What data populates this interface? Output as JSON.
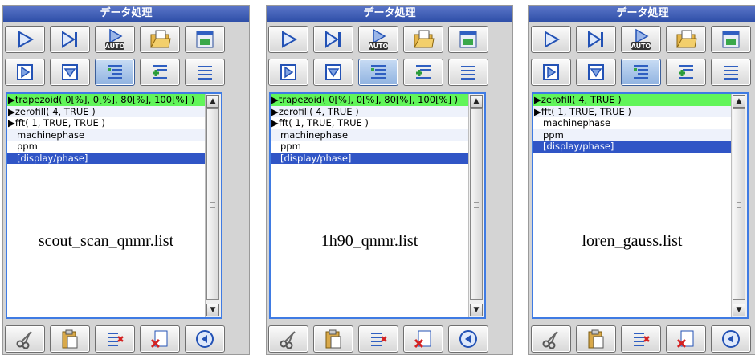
{
  "panels": [
    {
      "title": "データ処理",
      "items": [
        {
          "label": "▶trapezoid( 0[%], 0[%], 80[%], 100[%] )",
          "style": "green"
        },
        {
          "label": "▶zerofill( 4, TRUE )",
          "style": ""
        },
        {
          "label": "▶fft( 1, TRUE, TRUE )",
          "style": ""
        },
        {
          "label": "machinephase",
          "style": "indent"
        },
        {
          "label": "ppm",
          "style": "indent"
        },
        {
          "label": "[display/phase]",
          "style": "indent sel"
        }
      ],
      "filename": "scout_scan_qnmr.list"
    },
    {
      "title": "データ処理",
      "items": [
        {
          "label": "▶trapezoid( 0[%], 0[%], 80[%], 100[%] )",
          "style": "green"
        },
        {
          "label": "▶zerofill( 4, TRUE )",
          "style": ""
        },
        {
          "label": "▶fft( 1, TRUE, TRUE )",
          "style": ""
        },
        {
          "label": "machinephase",
          "style": "indent"
        },
        {
          "label": "ppm",
          "style": "indent"
        },
        {
          "label": "[display/phase]",
          "style": "indent sel"
        }
      ],
      "filename": "1h90_qnmr.list"
    },
    {
      "title": "データ処理",
      "items": [
        {
          "label": "▶zerofill( 4, TRUE )",
          "style": "green"
        },
        {
          "label": "▶fft( 1, TRUE, TRUE )",
          "style": ""
        },
        {
          "label": "machinephase",
          "style": "indent"
        },
        {
          "label": "ppm",
          "style": "indent"
        },
        {
          "label": "[display/phase]",
          "style": "indent sel"
        }
      ],
      "filename": "loren_gauss.list"
    }
  ],
  "toolbar_top": [
    {
      "icon": "play-icon",
      "label": ""
    },
    {
      "icon": "step-forward-icon",
      "label": ""
    },
    {
      "icon": "auto-icon",
      "label": "AUTO"
    },
    {
      "icon": "open-file-icon",
      "label": ""
    },
    {
      "icon": "save-file-icon",
      "label": ""
    }
  ],
  "toolbar_second": [
    {
      "icon": "frame-play-icon",
      "active": false
    },
    {
      "icon": "frame-down-icon",
      "active": false
    },
    {
      "icon": "list-add-icon",
      "active": true
    },
    {
      "icon": "list-insert-icon",
      "active": false
    },
    {
      "icon": "list-lines-icon",
      "active": false
    }
  ],
  "toolbar_bottom": [
    {
      "icon": "cut-icon"
    },
    {
      "icon": "paste-icon"
    },
    {
      "icon": "delete-item-icon"
    },
    {
      "icon": "clear-icon"
    },
    {
      "icon": "undo-icon"
    }
  ],
  "colors": {
    "accent": "#3f7be3",
    "selected": "#3055c6",
    "highlight": "#61f55a",
    "title": "#2f4fa8"
  }
}
